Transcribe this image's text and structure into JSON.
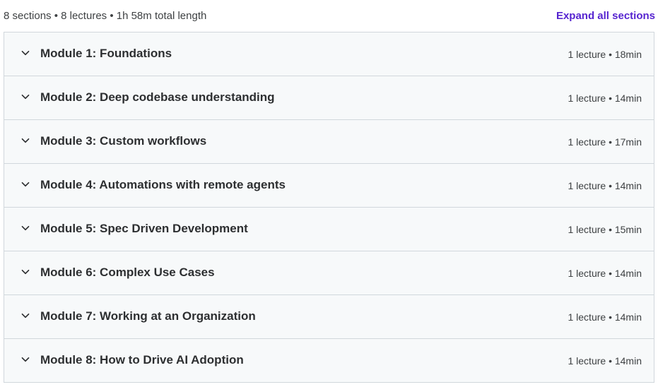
{
  "summary": {
    "text": "8 sections • 8 lectures • 1h 58m total length",
    "expand_label": "Expand all sections"
  },
  "colors": {
    "accent": "#5624d0",
    "row_background": "#f7f9fa",
    "border": "#d1d7dc"
  },
  "sections": [
    {
      "title": "Module 1: Foundations",
      "meta": "1 lecture • 18min",
      "icon": "chevron-down-icon"
    },
    {
      "title": "Module 2: Deep codebase understanding",
      "meta": "1 lecture • 14min",
      "icon": "chevron-down-icon"
    },
    {
      "title": "Module 3: Custom workflows",
      "meta": "1 lecture • 17min",
      "icon": "chevron-down-icon"
    },
    {
      "title": "Module 4: Automations with remote agents",
      "meta": "1 lecture • 14min",
      "icon": "chevron-down-icon"
    },
    {
      "title": "Module 5: Spec Driven Development",
      "meta": "1 lecture • 15min",
      "icon": "chevron-down-icon"
    },
    {
      "title": "Module 6: Complex Use Cases",
      "meta": "1 lecture • 14min",
      "icon": "chevron-down-icon"
    },
    {
      "title": "Module 7: Working at an Organization",
      "meta": "1 lecture • 14min",
      "icon": "chevron-down-icon"
    },
    {
      "title": "Module 8: How to Drive AI Adoption",
      "meta": "1 lecture • 14min",
      "icon": "chevron-down-icon"
    }
  ]
}
